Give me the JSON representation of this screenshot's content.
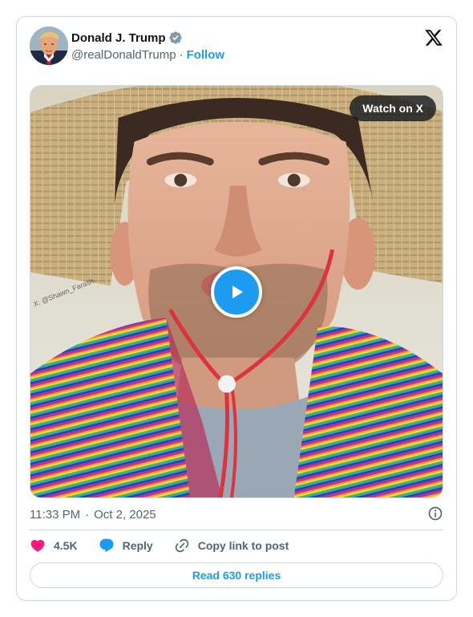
{
  "author": {
    "display_name": "Donald J. Trump",
    "handle": "@realDonaldTrump",
    "follow_label": "Follow",
    "verified": true,
    "separator": "·"
  },
  "media": {
    "watch_label": "Watch on X",
    "watermark": "X: @Shawn_Farash",
    "type": "video"
  },
  "meta": {
    "time": "11:33 PM",
    "separator": "·",
    "date": "Oct 2, 2025"
  },
  "actions": {
    "likes": "4.5K",
    "reply_label": "Reply",
    "copy_label": "Copy link to post"
  },
  "read_replies_label": "Read 630 replies",
  "colors": {
    "accent": "#1d9bf0",
    "like": "#f91880",
    "text_secondary": "#536471",
    "border": "#cfd9de"
  }
}
